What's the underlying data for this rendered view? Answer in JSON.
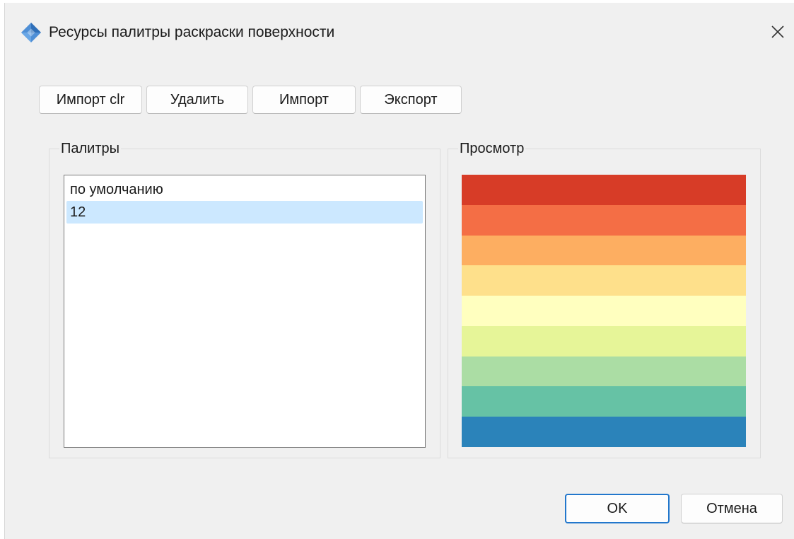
{
  "window": {
    "title": "Ресурсы палитры раскраски поверхности",
    "icon": "app-diamond-icon",
    "close_icon": "close-icon"
  },
  "toolbar": {
    "import_clr_label": "Импорт clr",
    "delete_label": "Удалить",
    "import_label": "Импорт",
    "export_label": "Экспорт"
  },
  "palettes": {
    "title": "Палитры",
    "items": [
      {
        "label": "по умолчанию",
        "selected": false
      },
      {
        "label": "12",
        "selected": true
      }
    ]
  },
  "preview": {
    "title": "Просмотр",
    "colors": [
      "#d73c27",
      "#f46e45",
      "#fdae61",
      "#fee08b",
      "#ffffbf",
      "#e6f598",
      "#abdda4",
      "#66c2a5",
      "#2b83ba"
    ]
  },
  "footer": {
    "ok_label": "OK",
    "cancel_label": "Отмена"
  },
  "colors": {
    "accent": "#2277cc",
    "selection": "#cce8ff",
    "background": "#f0f0f0"
  }
}
